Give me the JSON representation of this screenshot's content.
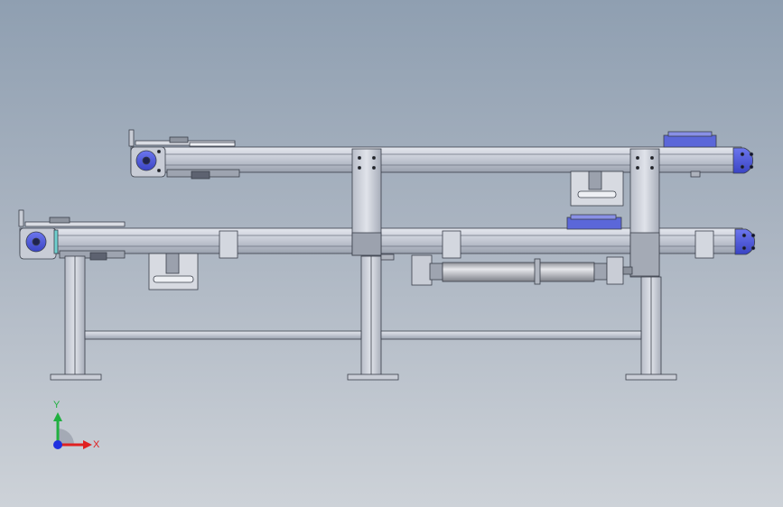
{
  "viewport": {
    "background_top": "#8f9fb1",
    "background_bottom": "#cdd2d8"
  },
  "model": {
    "part_color_frame": "#c3c8d4",
    "part_color_frame_edge": "#3a3f4a",
    "part_color_endcap": "#4d58d8",
    "part_color_cylinder": "#b9bcc3"
  },
  "triad": {
    "x_label": "X",
    "y_label": "Y",
    "x_color": "#e02020",
    "y_color": "#20b040",
    "z_color": "#2030e0"
  }
}
